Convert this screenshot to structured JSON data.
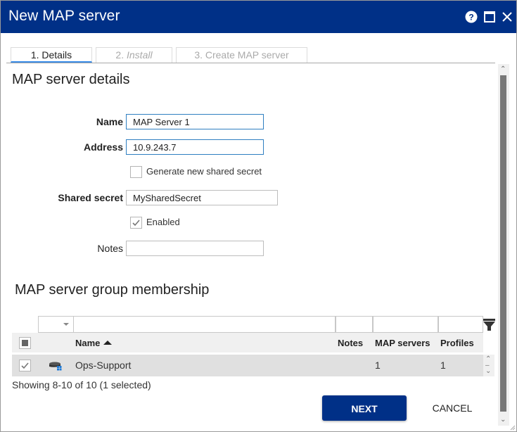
{
  "window": {
    "title": "New MAP server",
    "controls": {
      "help": "help-icon",
      "maximize": "maximize-icon",
      "close": "close-icon"
    }
  },
  "tabs": [
    {
      "label": "1. Details",
      "active": true
    },
    {
      "num": "2.",
      "label": "Install",
      "active": false
    },
    {
      "label": "3. Create MAP server",
      "active": false
    }
  ],
  "details": {
    "heading": "MAP server details",
    "name_label": "Name",
    "name_value": "MAP Server 1",
    "address_label": "Address",
    "address_value": "10.9.243.7",
    "generate_secret_label": "Generate new shared secret",
    "generate_secret_checked": false,
    "shared_secret_label": "Shared secret",
    "shared_secret_value": "MySharedSecret",
    "enabled_label": "Enabled",
    "enabled_checked": true,
    "notes_label": "Notes",
    "notes_value": ""
  },
  "membership": {
    "heading": "MAP server group membership",
    "filter_dropdown_value": "",
    "columns": [
      "Name",
      "Notes",
      "MAP servers",
      "Profiles"
    ],
    "sort": {
      "column": "Name",
      "direction": "ascending"
    },
    "rows": [
      {
        "checked": true,
        "icon": "server-group-icon",
        "name": "Ops-Support",
        "notes": "",
        "map_servers": "1",
        "profiles": "1"
      }
    ],
    "status": "Showing 8-10 of 10 (1 selected)"
  },
  "actions": {
    "next_label": "NEXT",
    "cancel_label": "CANCEL"
  },
  "colors": {
    "brand": "#003087",
    "tab_accent": "#3c8ee8",
    "focus_border": "#2f7fc1"
  }
}
